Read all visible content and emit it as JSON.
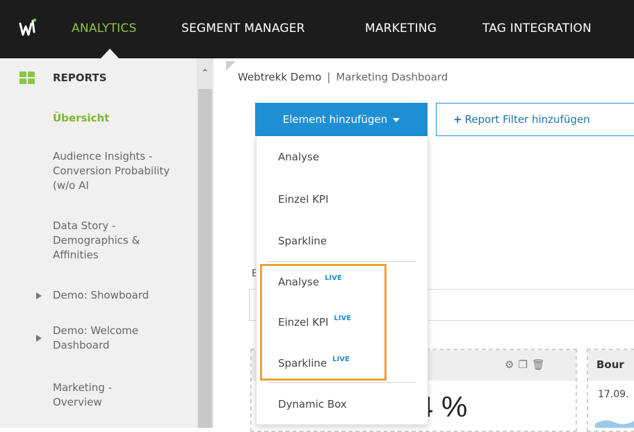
{
  "nav": {
    "logo_icon": "webtrekk-logo-icon",
    "items": [
      {
        "label": "ANALYTICS",
        "active": true
      },
      {
        "label": "SEGMENT MANAGER"
      },
      {
        "label": "MARKETING"
      },
      {
        "label": "TAG INTEGRATION"
      }
    ],
    "colors": {
      "background": "#1c1c1c",
      "active": "#8cc63f"
    }
  },
  "sidebar": {
    "title": "REPORTS",
    "items": [
      {
        "label": "Übersicht",
        "active": true
      },
      {
        "label": "Audience Insights - Conversion Probability (w/o AI"
      },
      {
        "label": "Data Story - Demographics & Affinities"
      },
      {
        "label": "Demo: Showboard",
        "expandable": true
      },
      {
        "label": "Demo: Welcome Dashboard",
        "expandable": true
      },
      {
        "label": "Marketing - Overview"
      }
    ]
  },
  "breadcrumb": {
    "first": "Webtrekk Demo",
    "separator": "|",
    "second": "Marketing Dashboard"
  },
  "toolbar": {
    "add_element_label": "Element hinzufügen",
    "add_filter_label": "Report Filter hinzufügen",
    "accent_color": "#1e8fd4"
  },
  "dropdown": {
    "items": [
      {
        "label": "Analyse"
      },
      {
        "label": "Einzel KPI"
      },
      {
        "label": "Sparkline"
      },
      {
        "label": "Analyse",
        "badge": "LIVE"
      },
      {
        "label": "Einzel KPI",
        "badge": "LIVE"
      },
      {
        "label": "Sparkline",
        "badge": "LIVE"
      },
      {
        "label": "Dynamic Box"
      }
    ],
    "highlight_color": "#f0a030"
  },
  "background": {
    "section_letter": "E",
    "widget1_value": "4 %",
    "widget1_icons": [
      "gear-icon",
      "copy-icon",
      "trash-icon"
    ],
    "widget2_title": "Bour",
    "widget2_date": "17.09."
  }
}
